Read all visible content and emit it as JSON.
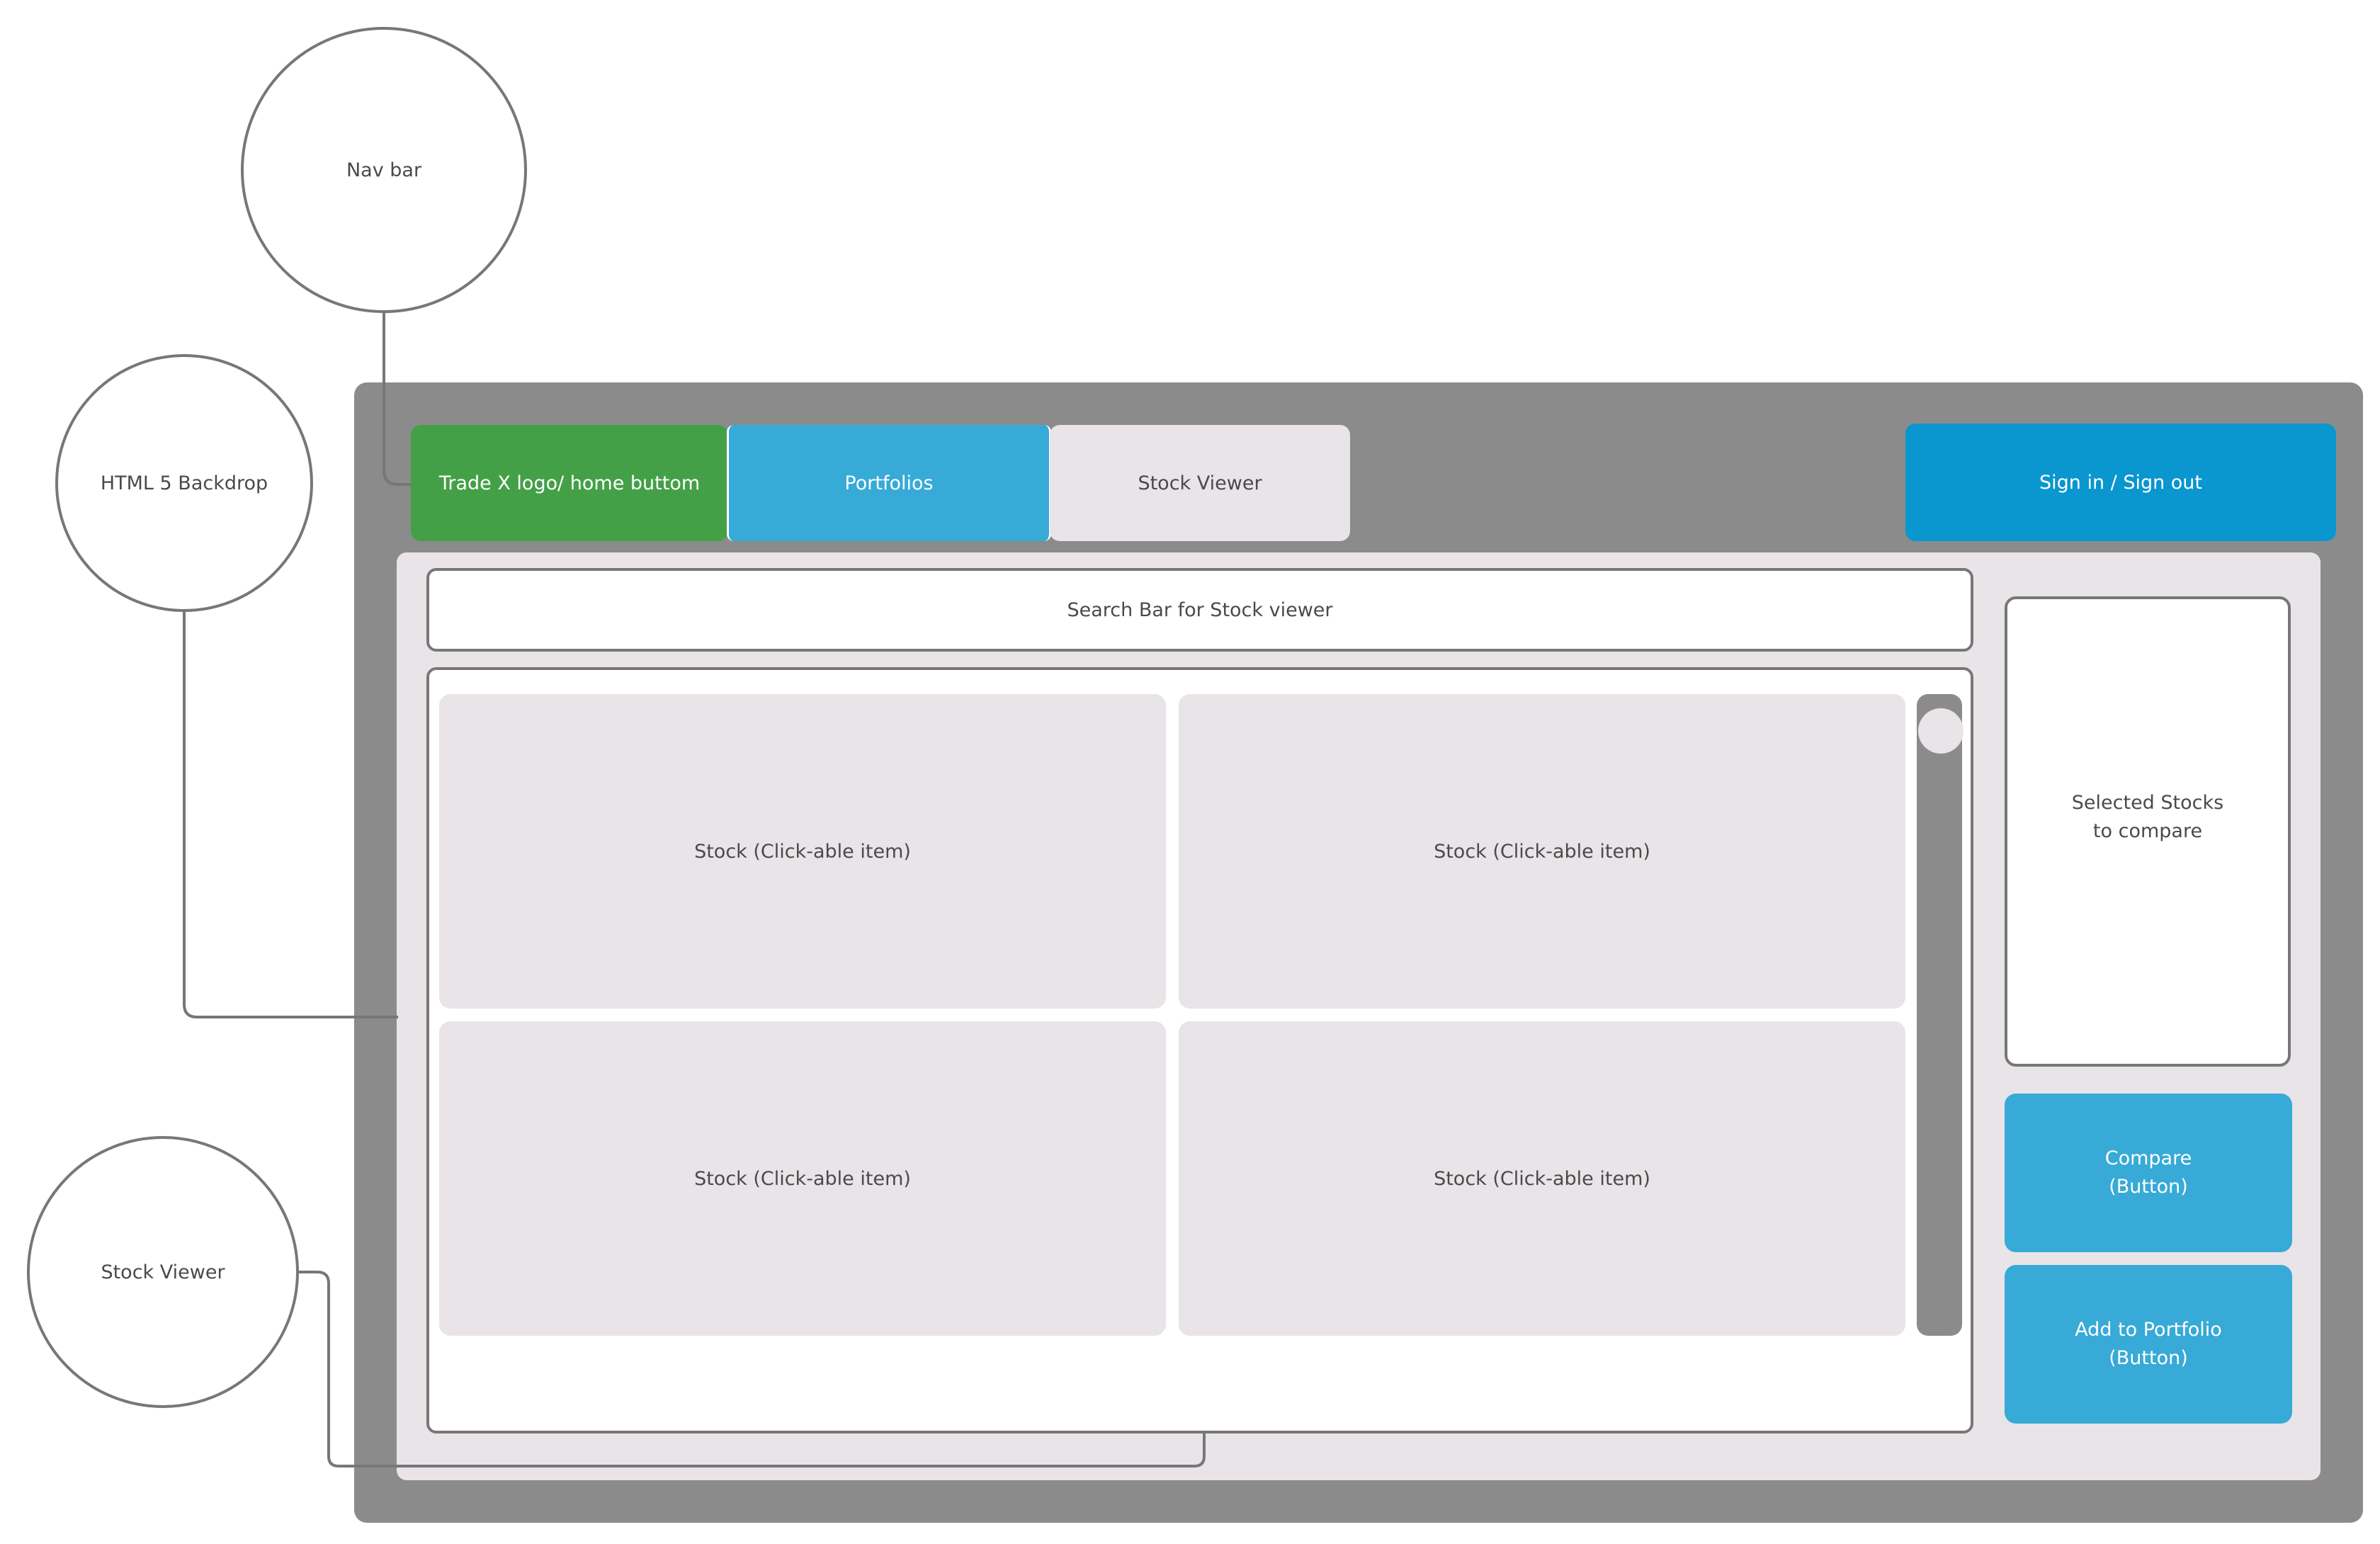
{
  "callouts": {
    "nav_bar": "Nav bar",
    "backdrop": "HTML 5 Backdrop",
    "stock_viewer": "Stock Viewer"
  },
  "nav": {
    "home": "Trade X logo/ home buttom",
    "portfolios": "Portfolios",
    "stock_viewer": "Stock Viewer",
    "sign_in_out": "Sign in / Sign out"
  },
  "search": {
    "label": "Search Bar for Stock viewer"
  },
  "stocks": [
    {
      "label": "Stock (Click-able item)"
    },
    {
      "label": "Stock (Click-able item)"
    },
    {
      "label": "Stock (Click-able item)"
    },
    {
      "label": "Stock (Click-able item)"
    }
  ],
  "sidebar": {
    "selected_label": "Selected Stocks\nto compare",
    "compare_button": "Compare\n(Button)",
    "add_portfolio_button": "Add to Portfolio\n(Button)"
  },
  "colors": {
    "backdrop": "#8b8b8b",
    "panel": "#e8e4e8",
    "home_green": "#44a047",
    "portfolios_blue": "#37aad7",
    "sign_in_blue": "#0a96cf",
    "outline": "#777777"
  }
}
